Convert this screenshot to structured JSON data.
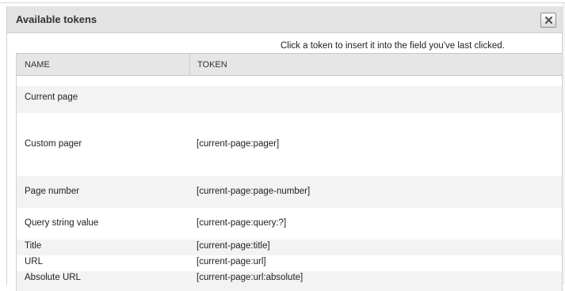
{
  "dialog": {
    "title": "Available tokens",
    "hint": "Click a token to insert it into the field you've last clicked.",
    "close_icon": "close-icon"
  },
  "table": {
    "headers": [
      "NAME",
      "TOKEN"
    ],
    "rows": [
      {
        "name": "Current page",
        "token": ""
      },
      {
        "name": "Custom pager",
        "token": "[current-page:pager]"
      },
      {
        "name": "Page number",
        "token": "[current-page:page-number]"
      },
      {
        "name": "Query string value",
        "token": "[current-page:query:?]"
      },
      {
        "name": "Title",
        "token": "[current-page:title]"
      },
      {
        "name": "URL",
        "token": "[current-page:url]"
      },
      {
        "name": "Absolute URL",
        "token": "[current-page:url:absolute]"
      }
    ]
  }
}
